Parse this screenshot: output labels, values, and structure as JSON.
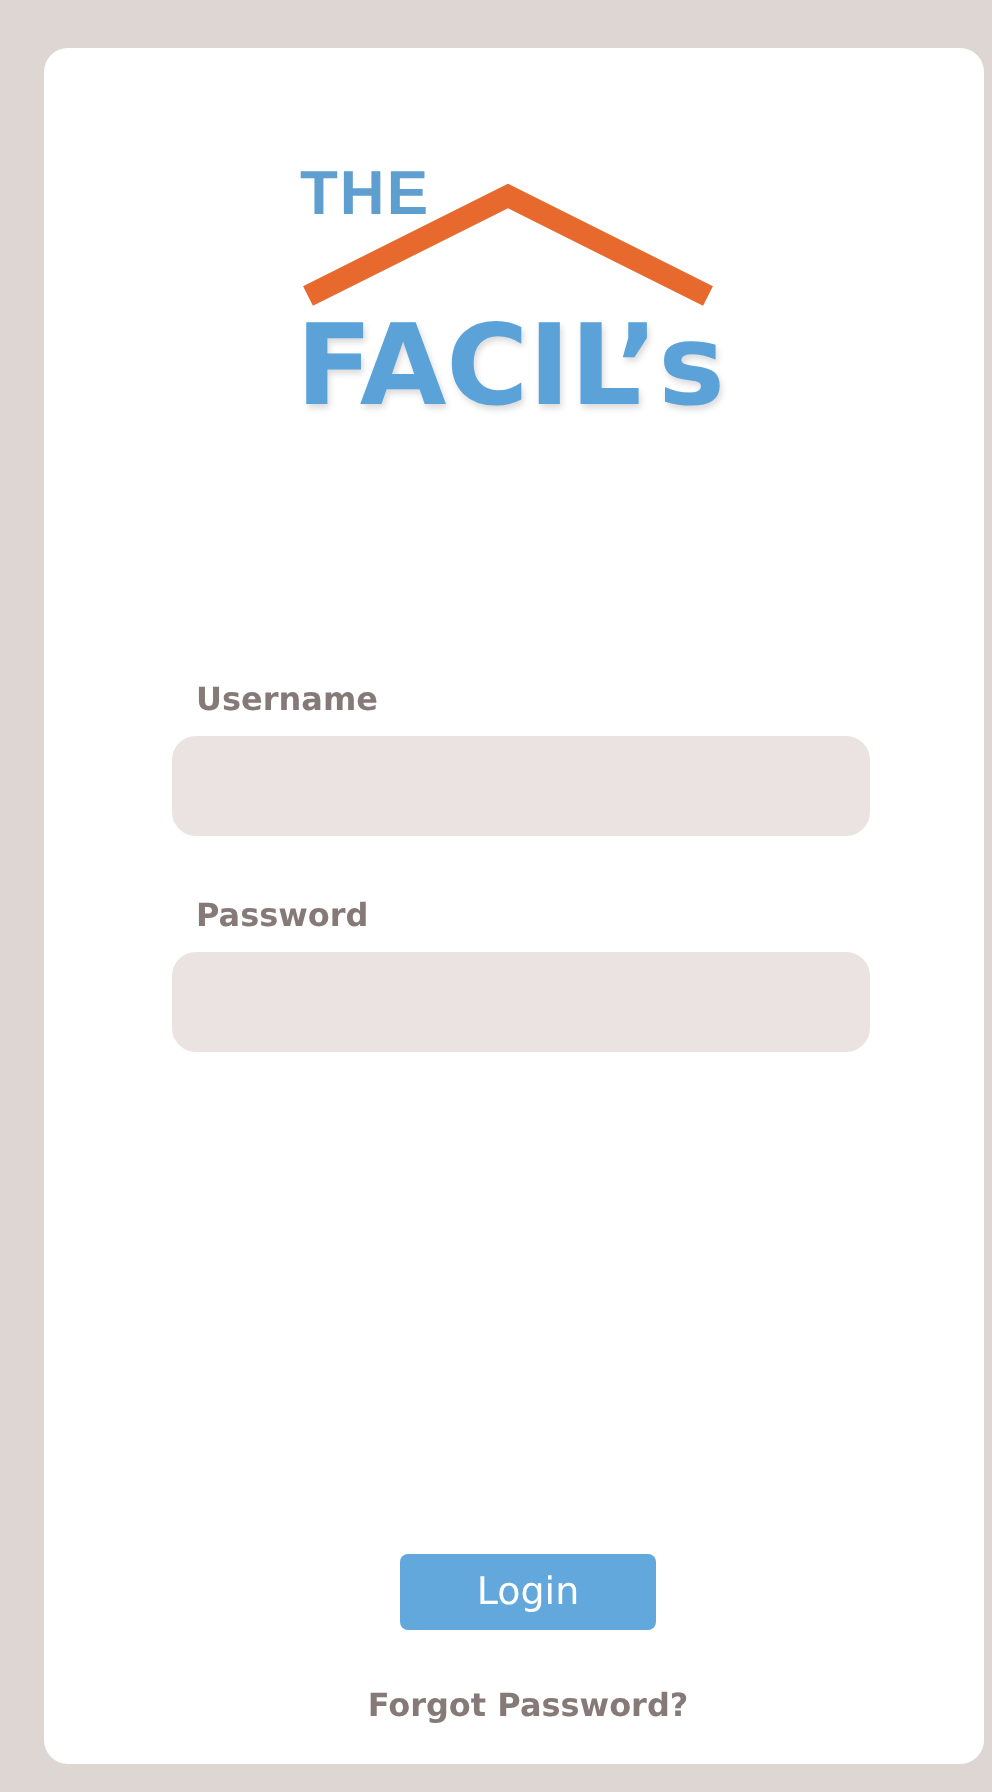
{
  "logo": {
    "top": "THE",
    "bottom": "FACIL’s"
  },
  "fields": [
    {
      "label": "Username"
    },
    {
      "label": "Password"
    }
  ],
  "login_button": "Login",
  "forgot_link": "Forgot Password?"
}
